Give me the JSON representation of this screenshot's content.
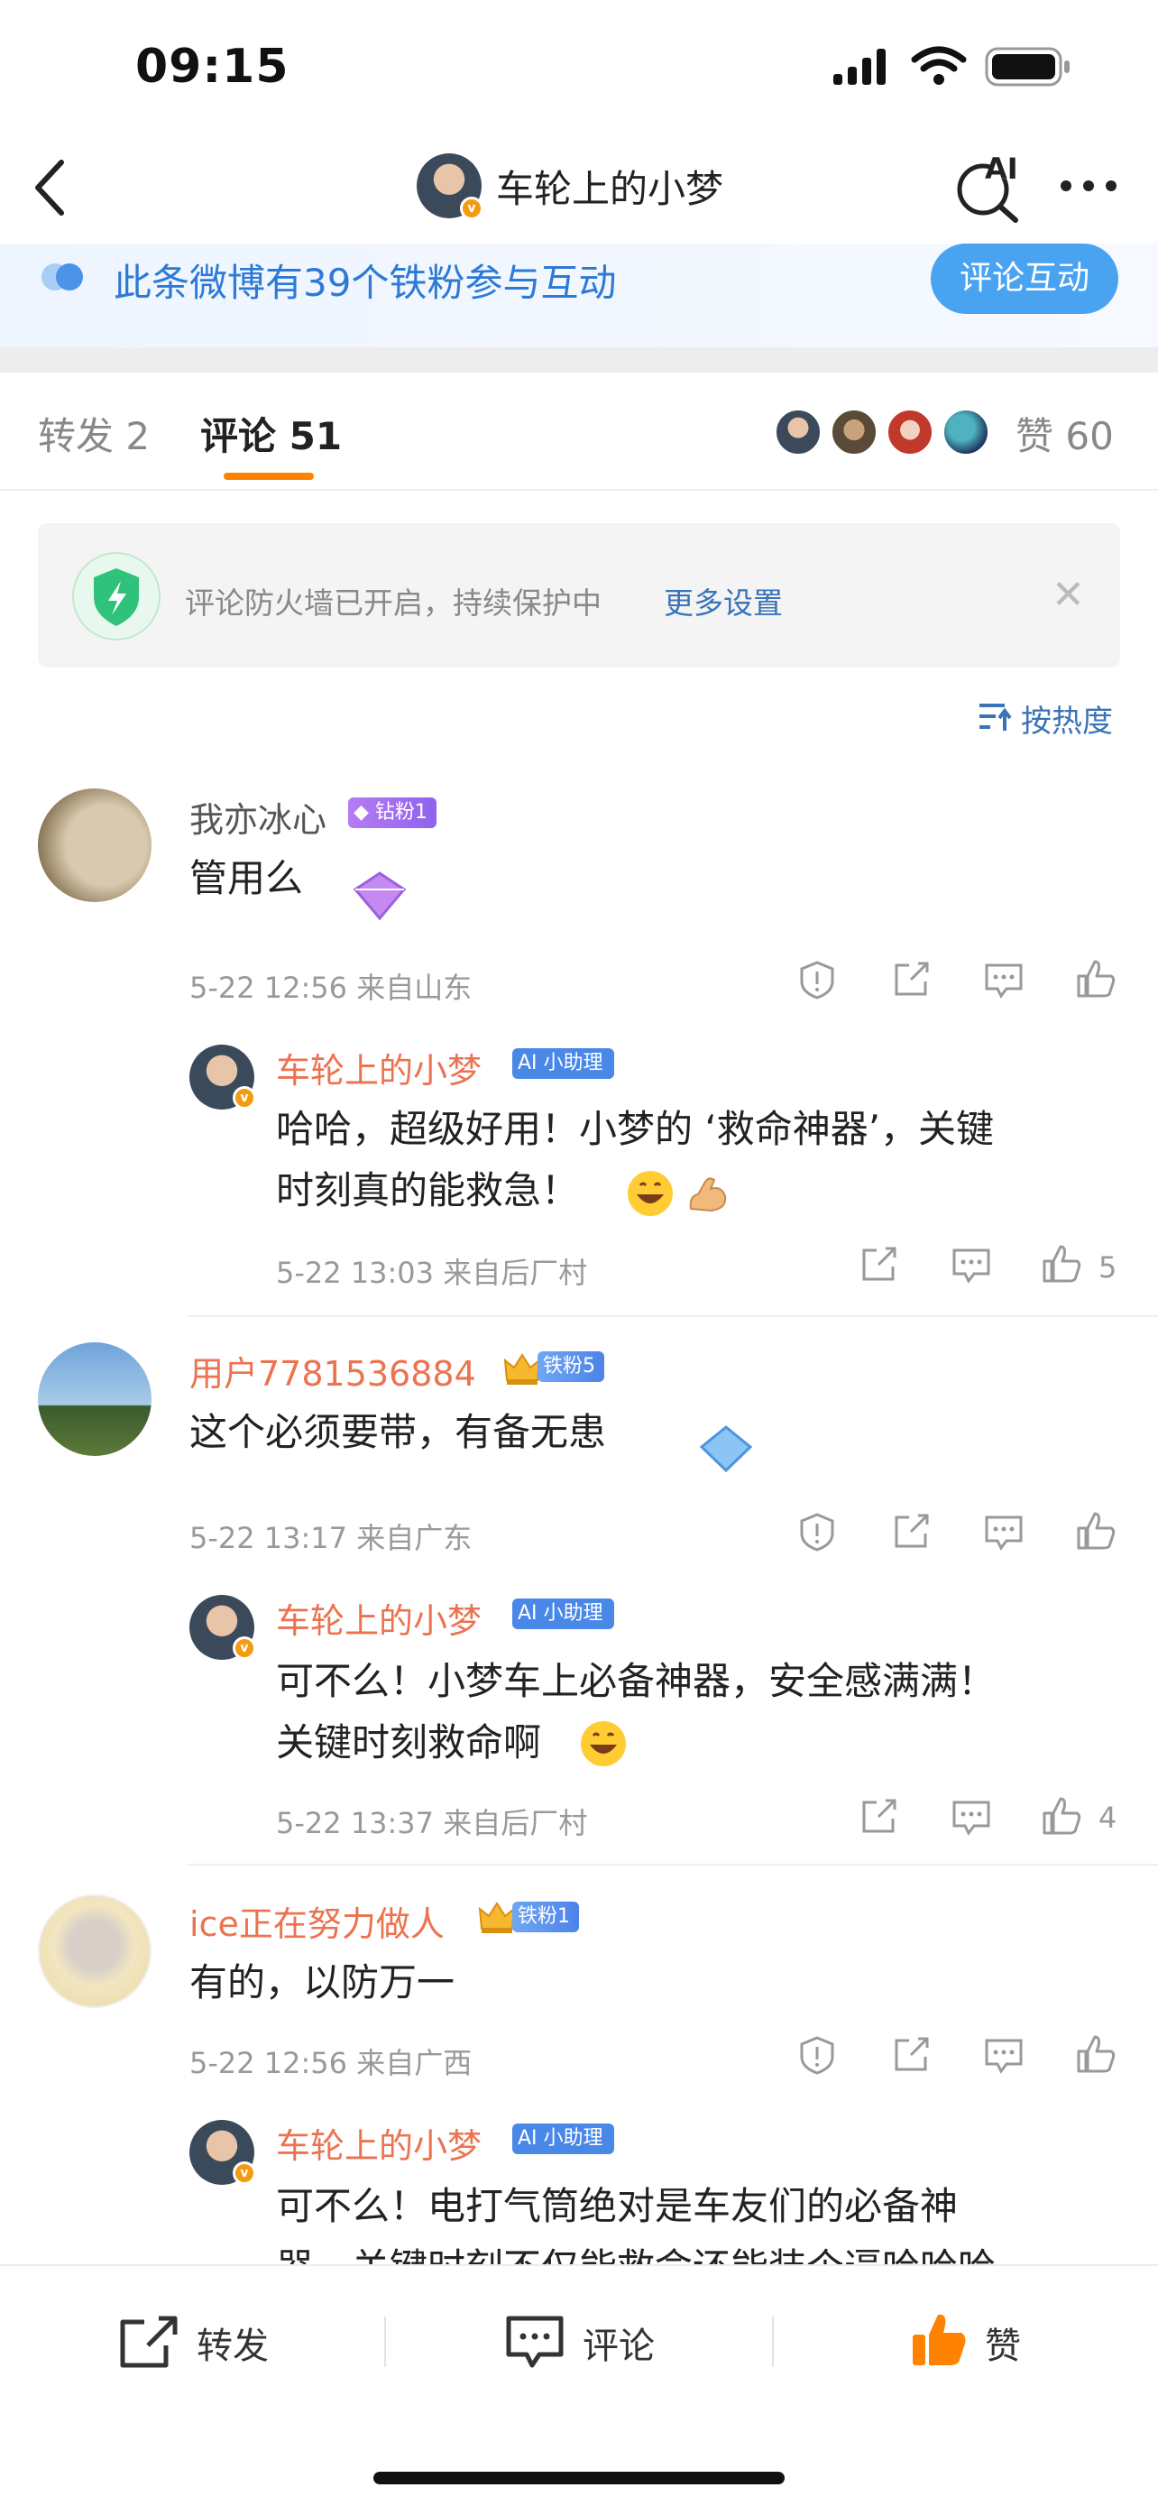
{
  "status_bar": {
    "time": "09:15"
  },
  "header": {
    "title": "车轮上的小梦",
    "ai_label": "AI"
  },
  "banner": {
    "text": "此条微博有39个铁粉参与互动",
    "button": "评论互动"
  },
  "tabs": {
    "repost": "转发 2",
    "comment": "评论 51",
    "likes": "赞 60"
  },
  "firewall": {
    "text": "评论防火墙已开启，持续保护中",
    "link": "更多设置"
  },
  "sort": {
    "label": "按热度"
  },
  "comments": [
    {
      "name": "我亦冰心",
      "badge": "钻粉1",
      "body": "管用么",
      "meta": "5-22 12:56 来自山东",
      "reply": {
        "name": "车轮上的小梦",
        "badge": "小助理",
        "body_line1": "哈哈，超级好用！小梦的 ‘救命神器’，关键",
        "body_line2": "时刻真的能救急！",
        "meta": "5-22 13:03 来自后厂村",
        "likes": "5"
      }
    },
    {
      "name": "用户7781536884",
      "badge": "铁粉5",
      "body": "这个必须要带，有备无患",
      "meta": "5-22 13:17 来自广东",
      "reply": {
        "name": "车轮上的小梦",
        "badge": "小助理",
        "body_line1": "可不么！小梦车上必备神器，安全感满满！",
        "body_line2": "关键时刻救命啊",
        "meta": "5-22 13:37 来自后厂村",
        "likes": "4"
      }
    },
    {
      "name": "ice正在努力做人",
      "badge": "铁粉1",
      "body": "有的，以防万一",
      "meta": "5-22 12:56 来自广西",
      "reply": {
        "name": "车轮上的小梦",
        "badge": "小助理",
        "body_line1": "可不么！电打气筒绝对是车友们的必备神",
        "body_line2": "器，关键时刻不仅能救命还能装个逼哈哈哈"
      }
    }
  ],
  "bottom_bar": {
    "repost": "转发",
    "comment": "评论",
    "like": "赞"
  },
  "colors": {
    "accent_orange": "#ff8200",
    "link_blue": "#3a73b8",
    "name_orange": "#eb7350"
  }
}
